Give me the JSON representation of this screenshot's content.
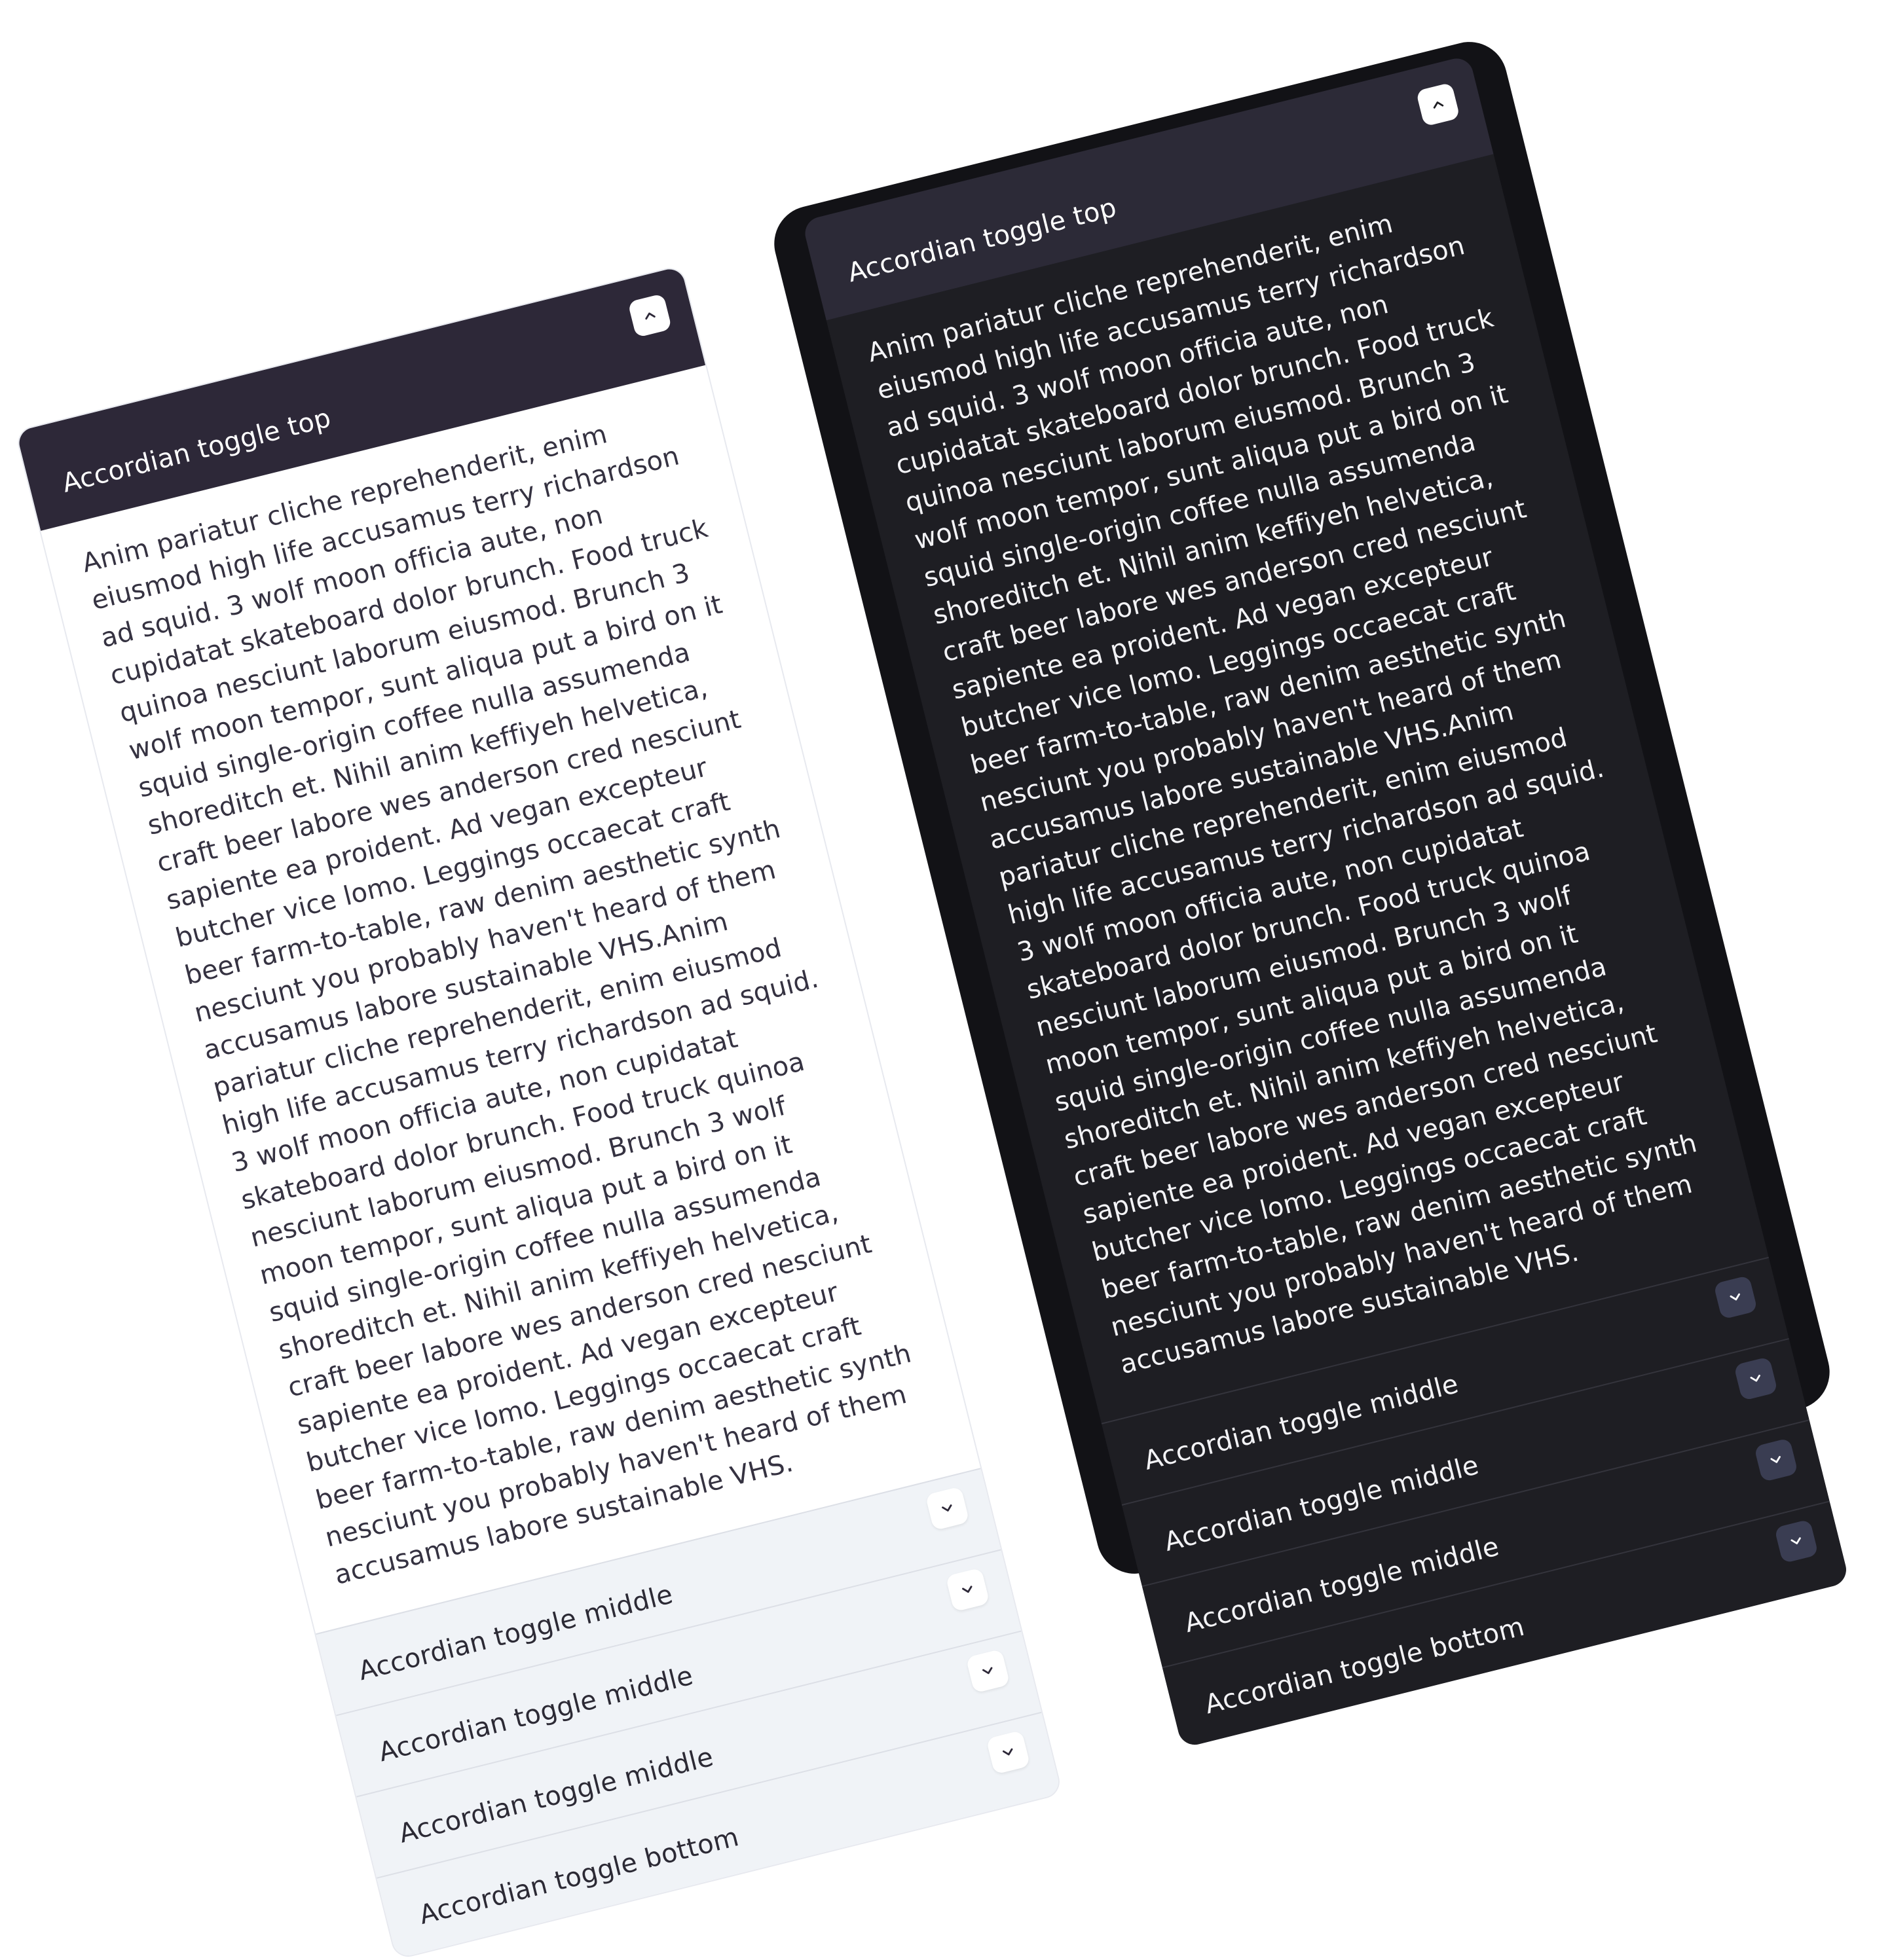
{
  "light": {
    "top_label": "Accordian toggle top",
    "body_text": "Anim pariatur cliche reprehenderit, enim eiusmod high life accusamus terry richardson ad squid. 3 wolf moon officia aute, non cupidatat skateboard dolor brunch. Food truck quinoa nesciunt laborum eiusmod. Brunch 3 wolf moon tempor, sunt aliqua put a bird on it squid single-origin coffee nulla assumenda shoreditch et. Nihil anim keffiyeh helvetica, craft beer labore wes anderson cred nesciunt sapiente ea proident. Ad vegan excepteur butcher vice lomo. Leggings occaecat craft beer farm-to-table, raw denim aesthetic synth nesciunt you probably haven't heard of them accusamus labore sustainable VHS.Anim pariatur cliche reprehenderit, enim eiusmod high life accusamus terry richardson ad squid. 3 wolf moon officia aute, non cupidatat skateboard dolor brunch. Food truck quinoa nesciunt laborum eiusmod. Brunch 3 wolf moon tempor, sunt aliqua put a bird on it squid single-origin coffee nulla assumenda shoreditch et. Nihil anim keffiyeh helvetica, craft beer labore wes anderson cred nesciunt sapiente ea proident. Ad vegan excepteur butcher vice lomo. Leggings occaecat craft beer farm-to-table, raw denim aesthetic synth nesciunt you probably haven't heard of them accusamus labore sustainable VHS.",
    "items": [
      {
        "label": "Accordian toggle middle",
        "icon": "chevron-down-icon"
      },
      {
        "label": "Accordian toggle middle",
        "icon": "chevron-down-icon"
      },
      {
        "label": "Accordian toggle middle",
        "icon": "chevron-down-icon"
      },
      {
        "label": "Accordian toggle bottom",
        "icon": "chevron-down-icon"
      }
    ]
  },
  "dark": {
    "top_label": "Accordian toggle top",
    "body_text": "Anim pariatur cliche reprehenderit, enim eiusmod high life accusamus terry richardson ad squid. 3 wolf moon officia aute, non cupidatat skateboard dolor brunch. Food truck quinoa nesciunt laborum eiusmod. Brunch 3 wolf moon tempor, sunt aliqua put a bird on it squid single-origin coffee nulla assumenda shoreditch et. Nihil anim keffiyeh helvetica, craft beer labore wes anderson cred nesciunt sapiente ea proident. Ad vegan excepteur butcher vice lomo. Leggings occaecat craft beer farm-to-table, raw denim aesthetic synth nesciunt you probably haven't heard of them accusamus labore sustainable VHS.Anim pariatur cliche reprehenderit, enim eiusmod high life accusamus terry richardson ad squid. 3 wolf moon officia aute, non cupidatat skateboard dolor brunch. Food truck quinoa nesciunt laborum eiusmod. Brunch 3 wolf moon tempor, sunt aliqua put a bird on it squid single-origin coffee nulla assumenda shoreditch et. Nihil anim keffiyeh helvetica, craft beer labore wes anderson cred nesciunt sapiente ea proident. Ad vegan excepteur butcher vice lomo. Leggings occaecat craft beer farm-to-table, raw denim aesthetic synth nesciunt you probably haven't heard of them accusamus labore sustainable VHS.",
    "items": [
      {
        "label": "Accordian toggle middle",
        "icon": "chevron-down-icon"
      },
      {
        "label": "Accordian toggle middle",
        "icon": "chevron-down-icon"
      },
      {
        "label": "Accordian toggle middle",
        "icon": "chevron-down-icon"
      },
      {
        "label": "Accordian toggle bottom",
        "icon": "chevron-down-icon"
      }
    ]
  },
  "icons": {
    "expanded": "chevron-up-icon",
    "collapsed": "chevron-down-icon"
  },
  "colors": {
    "header_bg": "#2d2838",
    "light_item_bg": "#f0f3f7",
    "dark_frame": "#121216",
    "dark_panel": "#1e1e23",
    "dark_chevron_bg": "#3a3d52"
  }
}
